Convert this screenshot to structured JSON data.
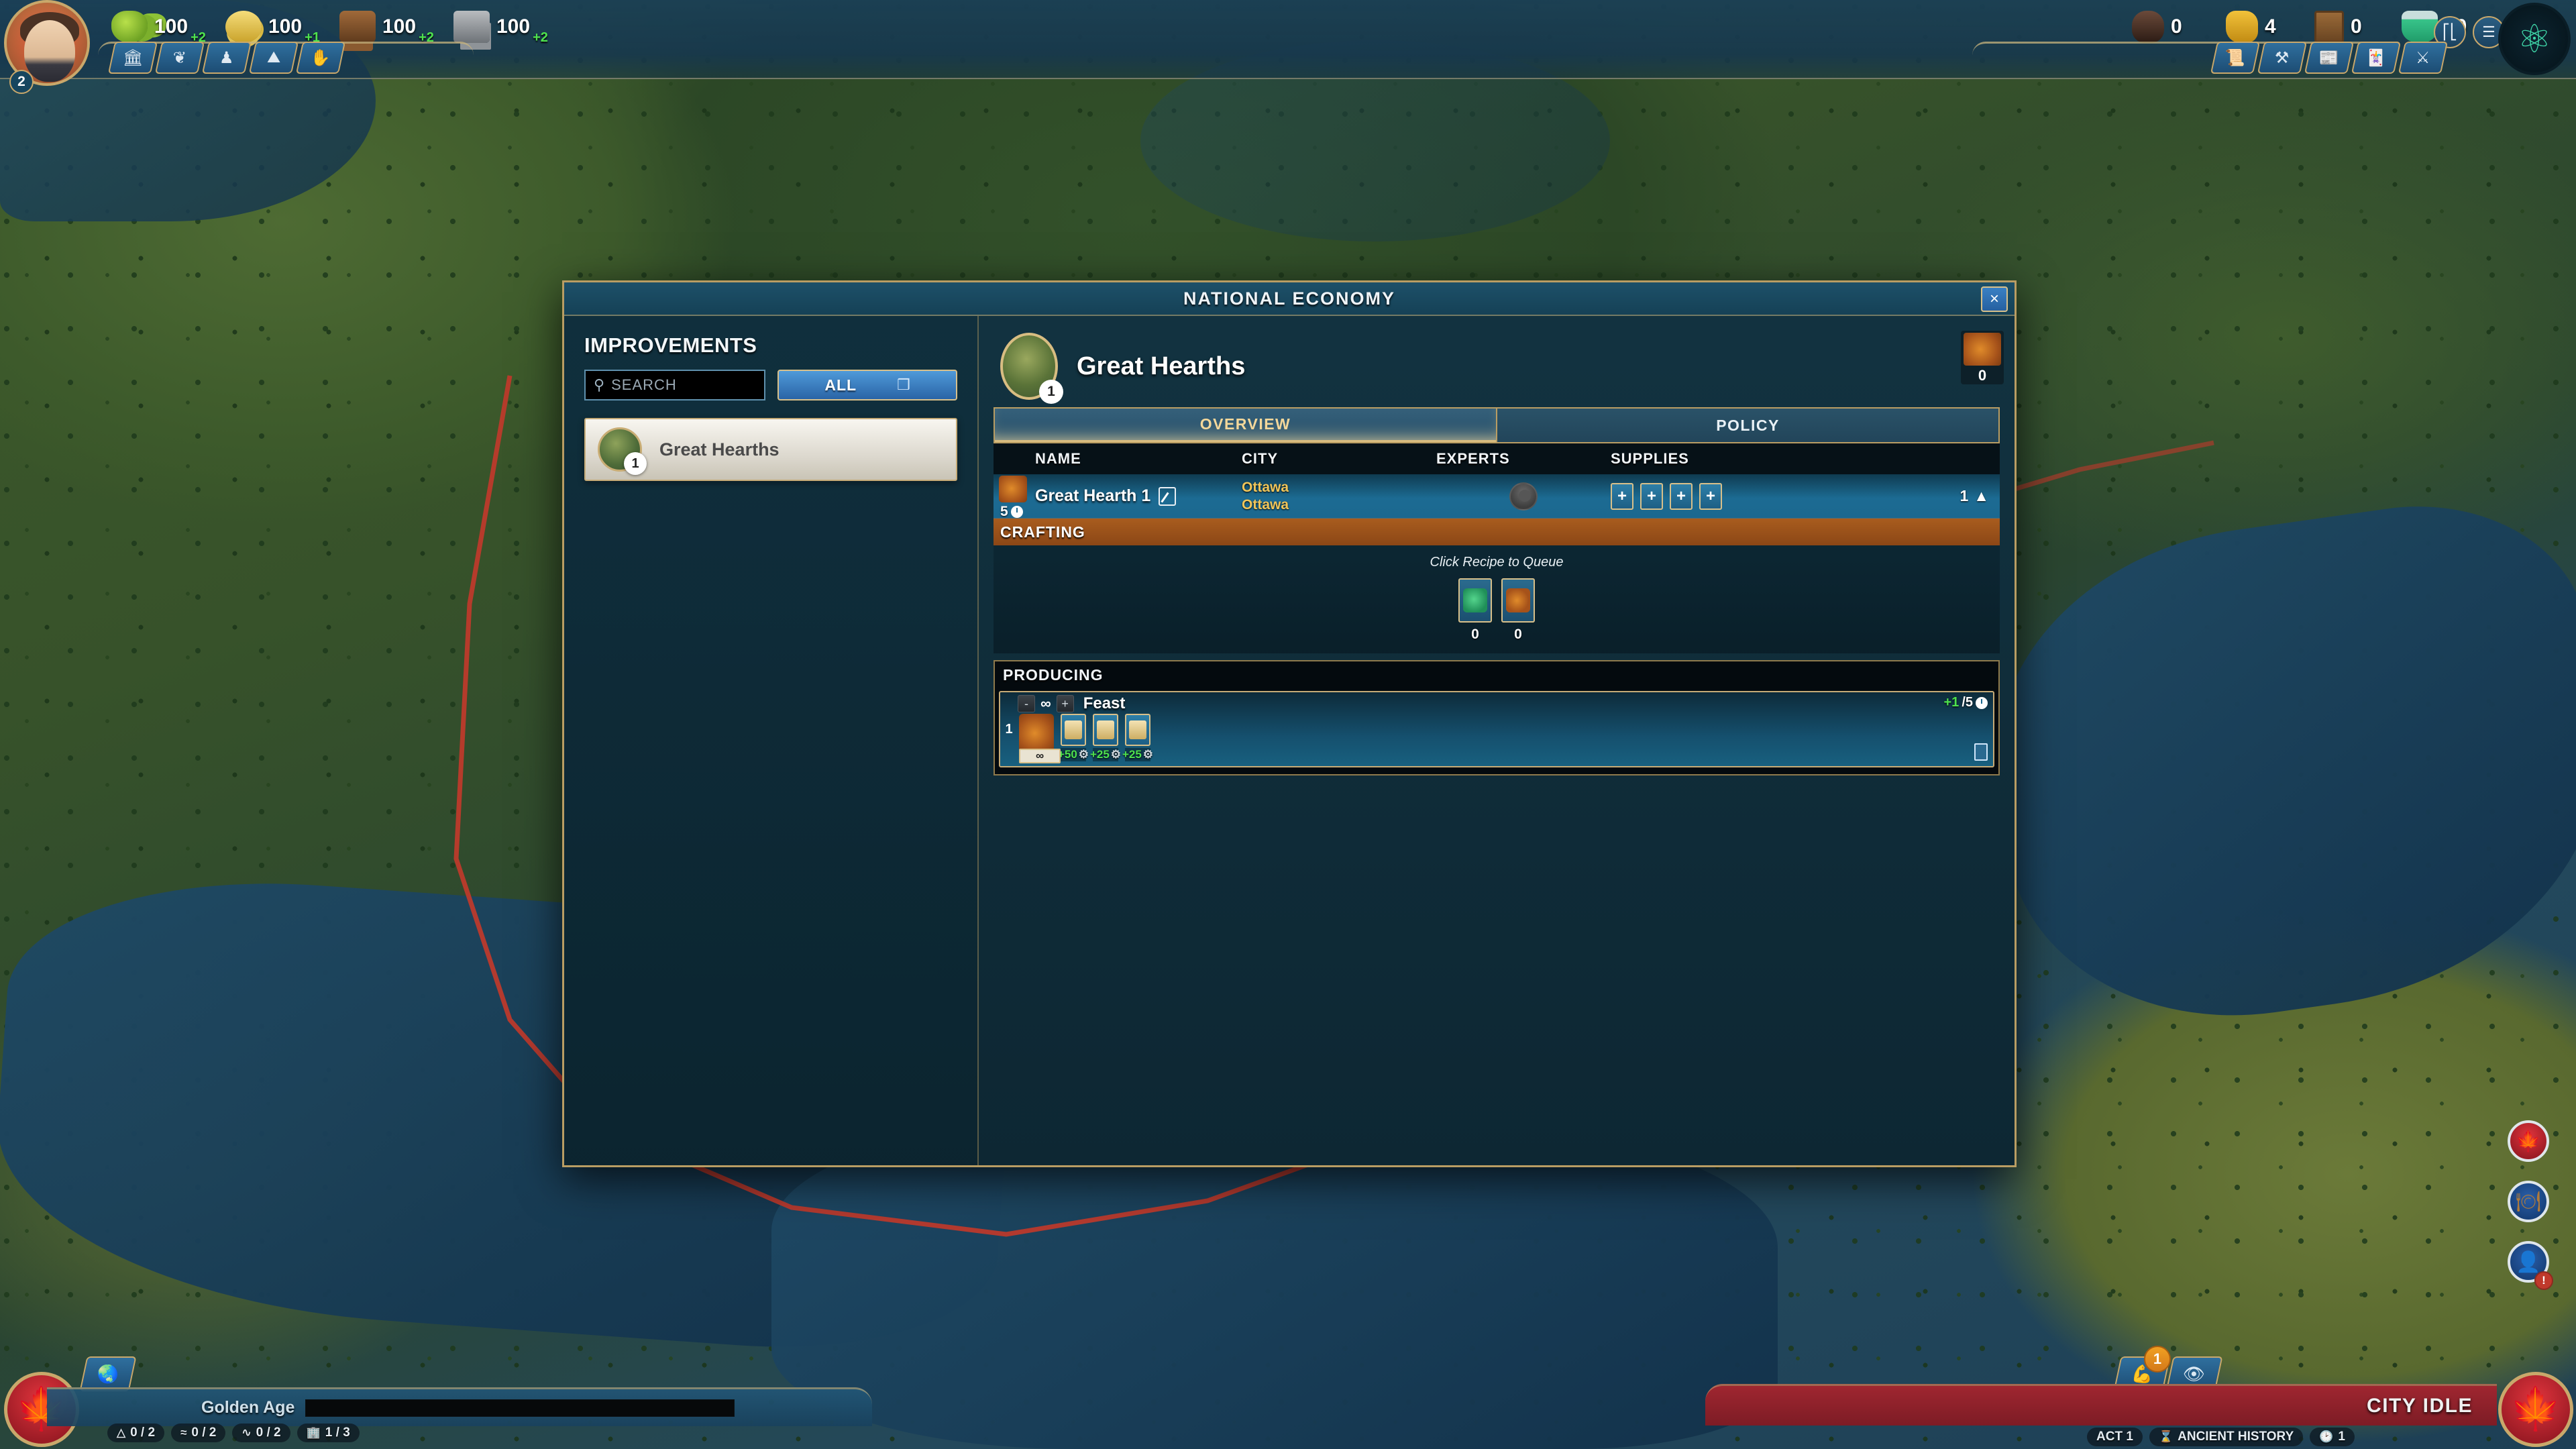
{
  "hud": {
    "leader": {
      "name": "leader-portrait",
      "era_badge": "2"
    },
    "resources": [
      {
        "icon": "food-icon",
        "amount": "100",
        "delta": "+2"
      },
      {
        "icon": "gold-icon",
        "amount": "100",
        "delta": "+1"
      },
      {
        "icon": "wood-icon",
        "amount": "100",
        "delta": "+2"
      },
      {
        "icon": "stone-icon",
        "amount": "100",
        "delta": "+2"
      }
    ],
    "resources_right": [
      {
        "icon": "iron-icon",
        "amount": "0"
      },
      {
        "icon": "gold-ore-icon",
        "amount": "4"
      },
      {
        "icon": "crate-icon",
        "amount": "0"
      },
      {
        "icon": "science-icon",
        "amount": "10"
      }
    ],
    "left_nav": [
      {
        "icon": "government-icon"
      },
      {
        "icon": "diplomacy-icon"
      },
      {
        "icon": "population-icon"
      },
      {
        "icon": "terrain-icon"
      },
      {
        "icon": "religion-icon"
      }
    ],
    "right_nav": [
      {
        "icon": "scroll-icon"
      },
      {
        "icon": "anvil-icon"
      },
      {
        "icon": "newspaper-icon"
      },
      {
        "icon": "card-icon"
      },
      {
        "icon": "military-icon"
      }
    ],
    "right_circles": [
      {
        "icon": "chart-icon"
      },
      {
        "icon": "menu-icon"
      }
    ],
    "tech_orb": {
      "icon": "atom-icon"
    }
  },
  "bottom": {
    "golden_age_label": "Golden Age",
    "add_icon": "add-unit-icon",
    "stats": [
      {
        "icon": "mountain-icon",
        "value": "0 / 2"
      },
      {
        "icon": "water-icon",
        "value": "0 / 2"
      },
      {
        "icon": "wonder-icon",
        "value": "0 / 2"
      },
      {
        "icon": "city-icon",
        "value": "1 / 3"
      }
    ],
    "city_idle_label": "CITY IDLE",
    "act_pills": [
      {
        "icon": "",
        "value": "ACT 1"
      },
      {
        "icon": "hourglass-icon",
        "value": "ANCIENT HISTORY"
      },
      {
        "icon": "clock-icon",
        "value": "1"
      }
    ],
    "right_hexes": [
      {
        "icon": "unit-select-icon",
        "badge": "1"
      },
      {
        "icon": "eye-icon",
        "badge": ""
      }
    ],
    "side_buttons": [
      {
        "icon": "flag-canada-icon"
      },
      {
        "icon": "barrel-icon"
      },
      {
        "icon": "advisor-icon",
        "alert": "!"
      }
    ]
  },
  "dialog": {
    "title": "NATIONAL ECONOMY",
    "close_label": "×",
    "left": {
      "heading": "IMPROVEMENTS",
      "search": {
        "placeholder": "SEARCH",
        "value": "",
        "icon": "search-icon"
      },
      "filter": {
        "label": "ALL",
        "chevron": "chevron-down-icon"
      },
      "items": [
        {
          "name": "Great Hearths",
          "count": "1",
          "thumb": "great-hearths-thumb"
        }
      ]
    },
    "detail": {
      "title": "Great Hearths",
      "count_badge": "1",
      "stock": {
        "icon": "feast-icon",
        "value": "0"
      },
      "tabs": [
        {
          "label": "OVERVIEW",
          "active": true
        },
        {
          "label": "POLICY",
          "active": false
        }
      ],
      "table": {
        "columns": [
          "NAME",
          "CITY",
          "EXPERTS",
          "SUPPLIES"
        ],
        "rows": [
          {
            "icon": "feast-icon",
            "turns": "5",
            "turns_icon": "clock-icon",
            "name": "Great Hearth 1",
            "edit_icon": "edit-icon",
            "city_line1": "Ottawa",
            "city_line2": "Ottawa",
            "experts": "",
            "supplies": [
              "+",
              "+",
              "+",
              "+"
            ],
            "level": "1",
            "collapse_icon": "caret-up-icon"
          }
        ]
      },
      "crafting": {
        "header": "CRAFTING",
        "hint": "Click Recipe to Queue",
        "recipes": [
          {
            "icon": "herbs-icon",
            "qty": "0"
          },
          {
            "icon": "feast-icon",
            "qty": "0"
          }
        ]
      },
      "producing": {
        "header": "PRODUCING",
        "queue": [
          {
            "index": "1",
            "dec_label": "-",
            "inc_label": "+",
            "repeat_symbol": "∞",
            "name": "Feast",
            "rate": "+1",
            "rate_denom": "/5",
            "rate_icon": "clock-icon",
            "art": "feast-icon",
            "repeat_bar": "∞",
            "outputs": [
              {
                "icon": "bread-icon",
                "value": "+50",
                "stat_icon": "cog-icon"
              },
              {
                "icon": "bread-icon",
                "value": "+25",
                "stat_icon": "cog-icon"
              },
              {
                "icon": "bread-icon",
                "value": "+25",
                "stat_icon": "cog-icon"
              }
            ],
            "delete_icon": "trash-icon"
          }
        ]
      }
    }
  },
  "colors": {
    "accent_gold": "#d8c08a",
    "panel_blue": "#123341",
    "crafting_orange": "#a85c1e",
    "positive_green": "#4ee24e",
    "city_yellow": "#f0c55a"
  }
}
